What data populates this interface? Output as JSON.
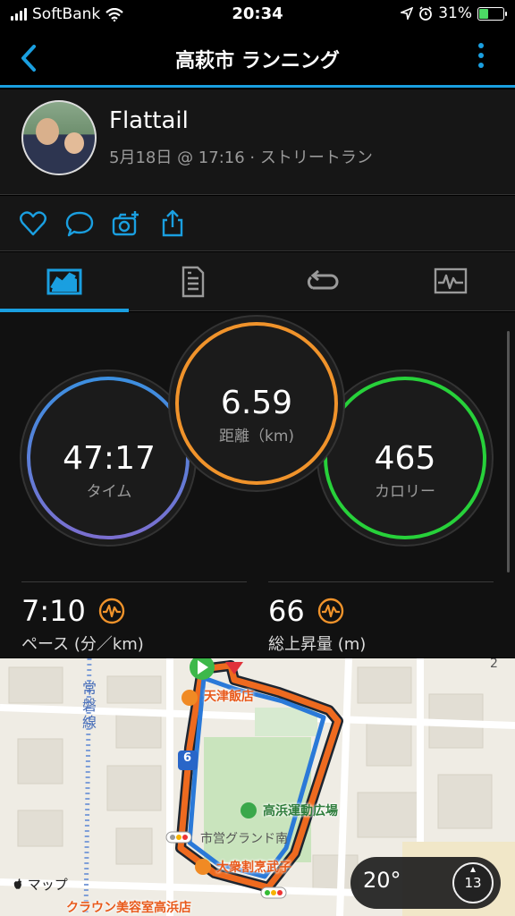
{
  "status_bar": {
    "carrier": "SoftBank",
    "time": "20:34",
    "battery_text": "31%"
  },
  "nav": {
    "title": "高萩市 ランニング",
    "back_icon": "chevron-left-icon",
    "more_icon": "vertical-dots-icon"
  },
  "profile": {
    "name": "Flattail",
    "meta": "5月18日 @ 17:16 · ストリートラン"
  },
  "actions": [
    "heart-icon",
    "comment-icon",
    "camera-add-icon",
    "share-icon"
  ],
  "tabs": [
    {
      "icon": "summary-chart-icon",
      "active": true
    },
    {
      "icon": "details-list-icon",
      "active": false
    },
    {
      "icon": "laps-loop-icon",
      "active": false
    },
    {
      "icon": "graph-monitor-icon",
      "active": false
    }
  ],
  "stats": {
    "time": {
      "value": "47:17",
      "label": "タイム"
    },
    "distance": {
      "value": "6.59",
      "label": "距離（km)"
    },
    "calories": {
      "value": "465",
      "label": "カロリー"
    },
    "pace": {
      "value": "7:10",
      "label": "ペース (分／km)"
    },
    "elevation": {
      "value": "66",
      "label": "総上昇量 (m)"
    }
  },
  "colors": {
    "accent": "#1a9fe0",
    "time_ring_start": "#3c8fe0",
    "time_ring_end": "#7b6fd0",
    "distance_ring": "#f0932b",
    "calories_ring": "#27d13a",
    "metric_icon": "#f0932b"
  },
  "map": {
    "labels": {
      "rail": "常磐線",
      "restaurant1": "天津飯店",
      "park": "高浜運動広場",
      "street": "市営グランド南",
      "restaurant2": "大衆割烹武子",
      "shop": "クラウン美容室高浜店",
      "route_number": "6",
      "corner_number": "2"
    },
    "attribution": "マップ",
    "weather": {
      "temp": "20°",
      "wind": "13"
    }
  }
}
